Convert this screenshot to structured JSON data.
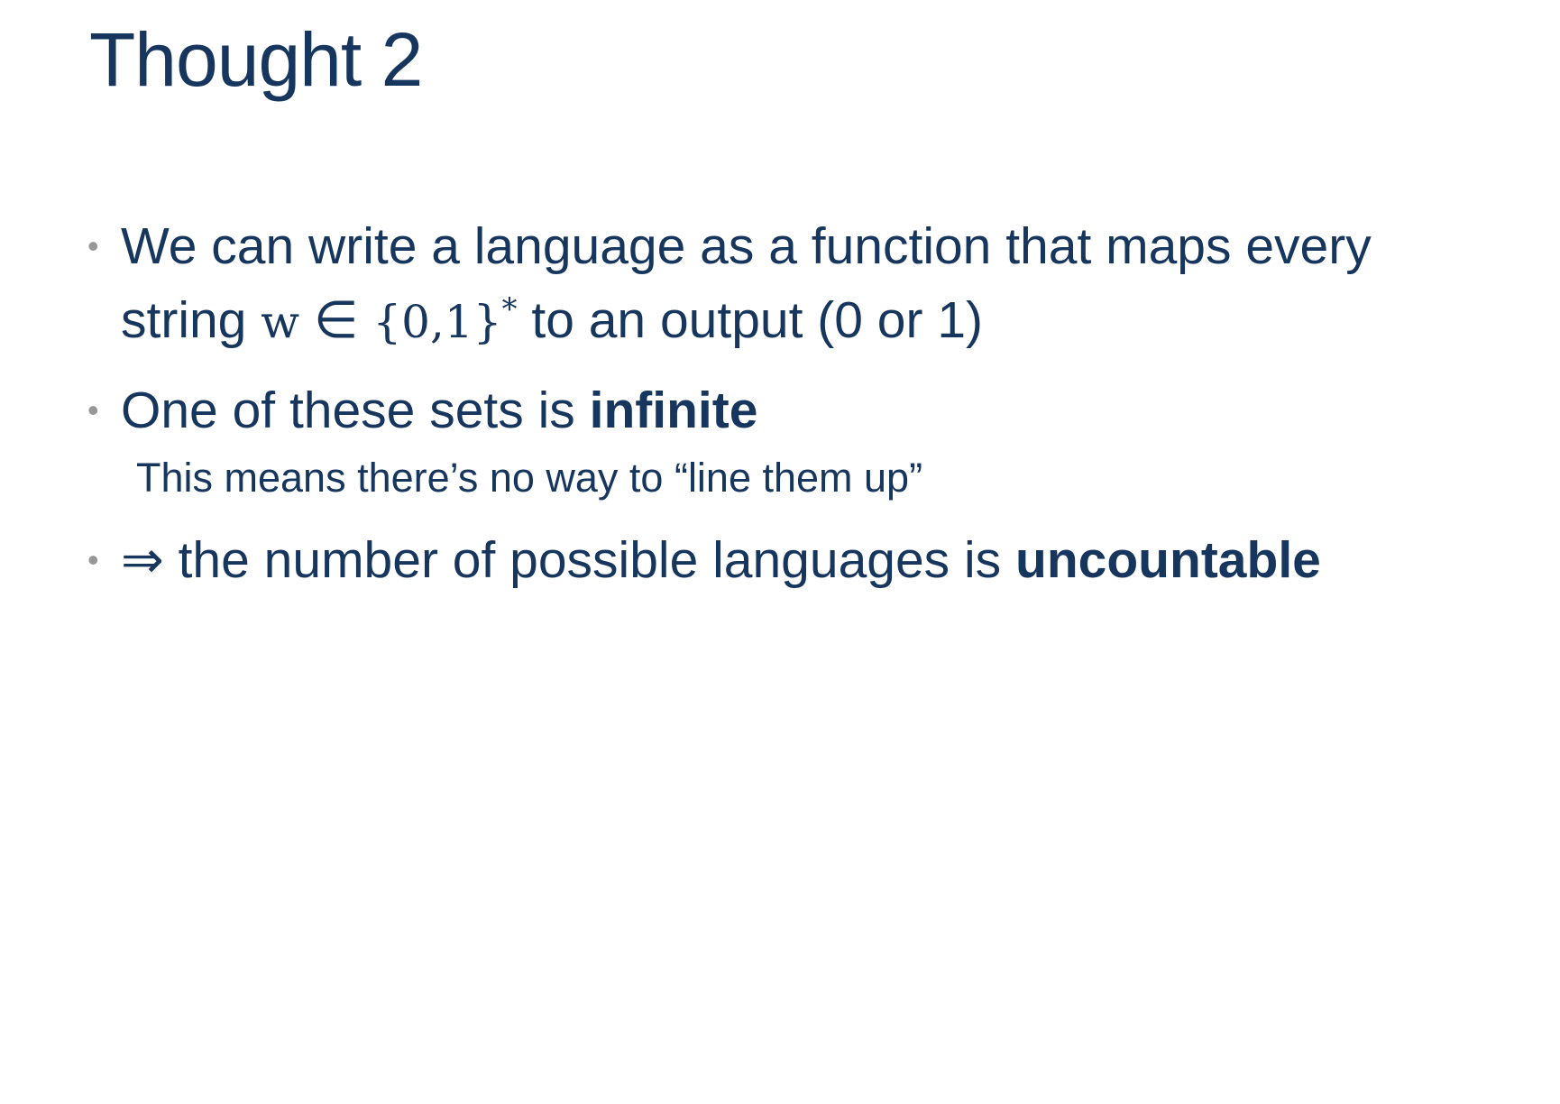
{
  "slide": {
    "title": "Thought 2",
    "bullets": [
      {
        "marker": "•",
        "line1": "We can write a language as a function that maps every",
        "line2_pre": "string ",
        "math_w": "w",
        "math_in": " ∈ ",
        "math_set": "{0,1}",
        "math_star": "*",
        "line2_post": " to an output (0 or 1)"
      },
      {
        "marker": "•",
        "text_pre": "One of these sets is ",
        "text_bold": "infinite",
        "sub": "This means there’s no way to “line them up”"
      },
      {
        "marker": "•",
        "text_pre": "⇒ the number of possible languages is ",
        "text_bold": "uncountable"
      }
    ]
  },
  "colors": {
    "text": "#17365d",
    "bullet": "#979797",
    "background": "#ffffff"
  }
}
